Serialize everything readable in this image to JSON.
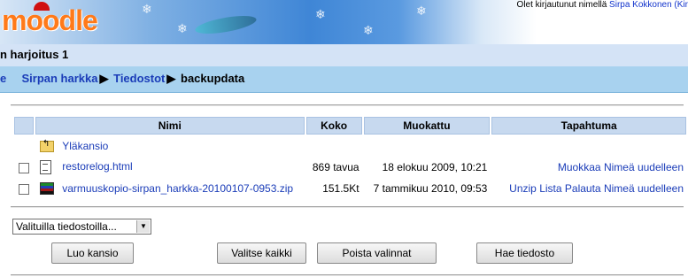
{
  "header": {
    "logo_text": "moodle",
    "login_text": "Olet kirjautunut nimellä ",
    "login_user": "Sirpa Kokkonen",
    "login_suffix": " (Kir"
  },
  "course_title": "n harjoitus 1",
  "breadcrumb": {
    "items": [
      "e",
      "Sirpan harkka",
      "Tiedostot"
    ],
    "current": "backupdata",
    "separator": "▶"
  },
  "table": {
    "columns": [
      "Nimi",
      "Koko",
      "Muokattu",
      "Tapahtuma"
    ],
    "parent_folder": "Yläkansio",
    "rows": [
      {
        "name": "restorelog.html",
        "size": "869 tavua",
        "modified": "18 elokuu 2009, 10:21",
        "actions": [
          "Muokkaa",
          "Nimeä uudelleen"
        ]
      },
      {
        "name": "varmuuskopio-sirpan_harkka-20100107-0953.zip",
        "size": "151.5Kt",
        "modified": "7 tammikuu 2010, 09:53",
        "actions": [
          "Unzip",
          "Lista",
          "Palauta",
          "Nimeä uudelleen"
        ]
      }
    ]
  },
  "selection": {
    "dropdown_value": "Valituilla tiedostoilla..."
  },
  "buttons": {
    "create_folder": "Luo kansio",
    "select_all": "Valitse kaikki",
    "deselect": "Poista valinnat",
    "upload": "Hae tiedosto"
  },
  "colors": {
    "link": "#1a3cb8",
    "header_cell": "#c7d9ef",
    "breadcrumb_bg": "#a8d2ef"
  }
}
